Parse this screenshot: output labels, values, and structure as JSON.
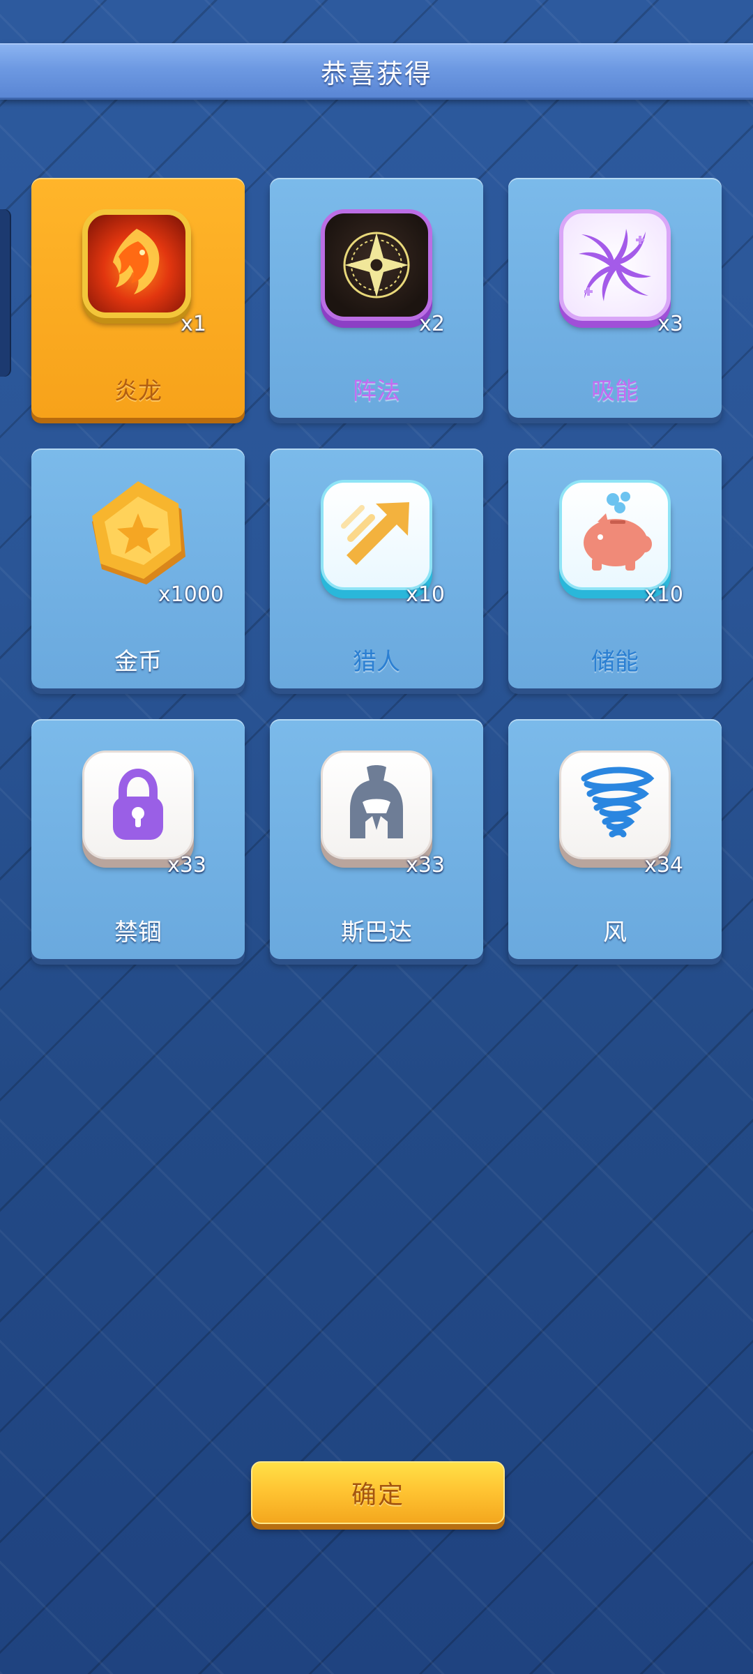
{
  "header": {
    "title": "恭喜获得"
  },
  "rewards": [
    {
      "name": "炎龙",
      "quantity": "x1",
      "icon": "fire-dragon-icon"
    },
    {
      "name": "阵法",
      "quantity": "x2",
      "icon": "magic-array-icon"
    },
    {
      "name": "吸能",
      "quantity": "x3",
      "icon": "absorb-swirl-icon"
    },
    {
      "name": "金币",
      "quantity": "x1000",
      "icon": "gold-coin-icon"
    },
    {
      "name": "猎人",
      "quantity": "x10",
      "icon": "hunter-arrow-icon"
    },
    {
      "name": "储能",
      "quantity": "x10",
      "icon": "piggy-bank-icon"
    },
    {
      "name": "禁锢",
      "quantity": "x33",
      "icon": "lock-icon"
    },
    {
      "name": "斯巴达",
      "quantity": "x33",
      "icon": "spartan-helmet-icon"
    },
    {
      "name": "风",
      "quantity": "x34",
      "icon": "tornado-icon"
    }
  ],
  "footer": {
    "confirm_label": "确定"
  },
  "colors": {
    "background": "#27508f",
    "card": "#6fb0e3",
    "highlight_card": "#f7a21a",
    "confirm_button": "#ffc533"
  }
}
